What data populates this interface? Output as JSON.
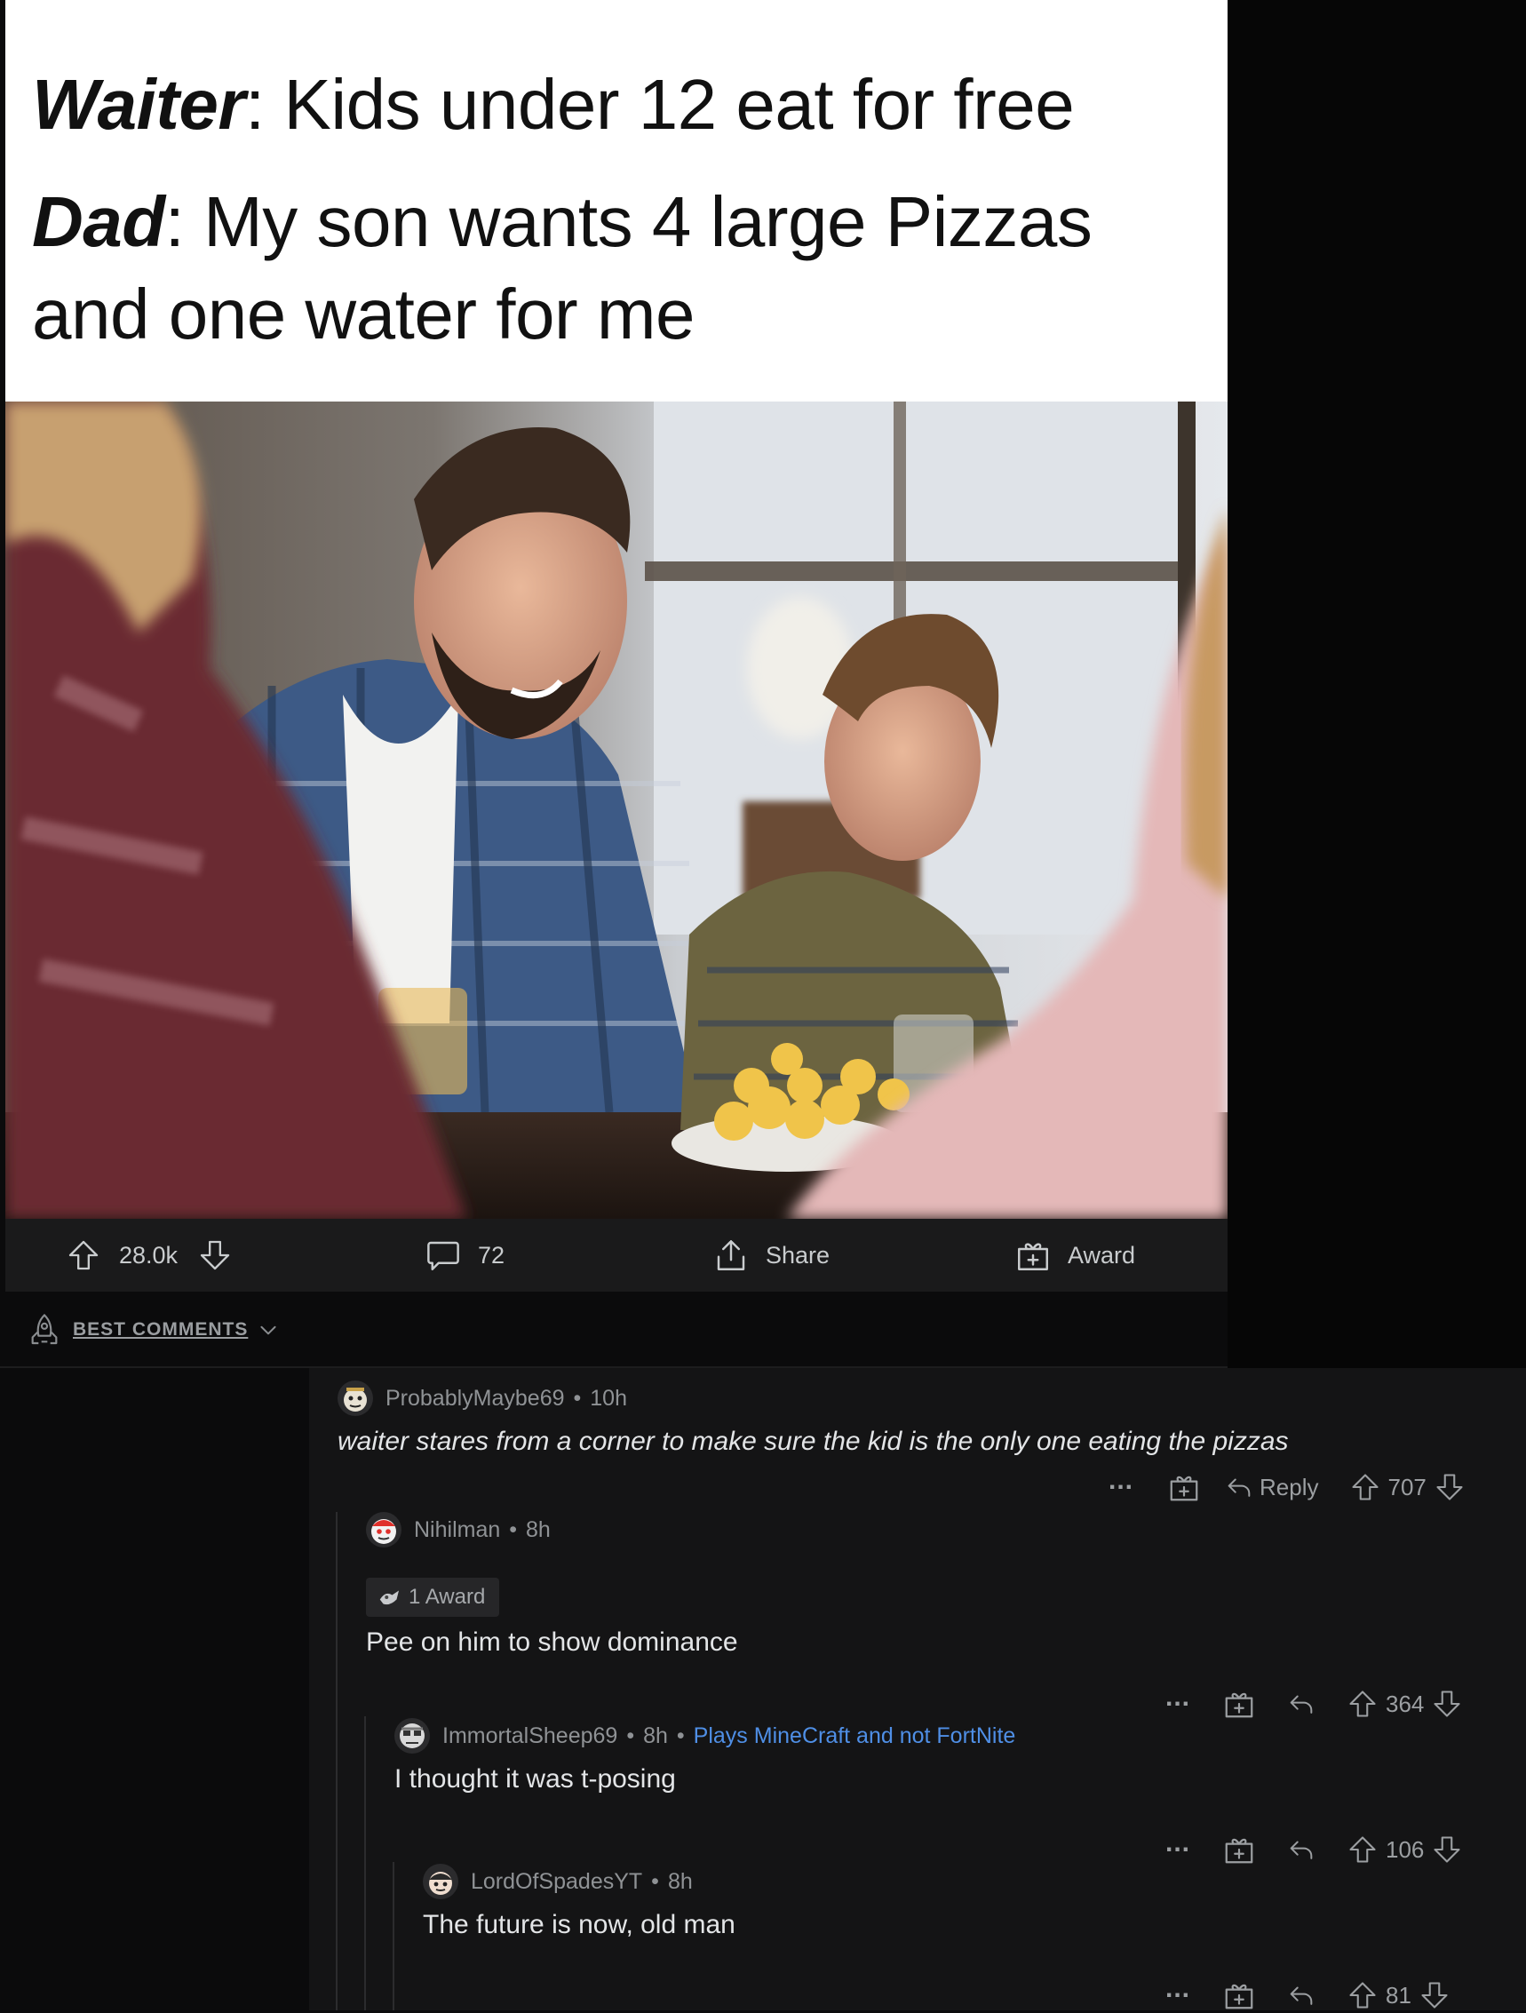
{
  "meme": {
    "waiter_speaker": "Waiter",
    "waiter_line": ": Kids under 12 eat for free",
    "dad_speaker": "Dad",
    "dad_line_1": ": My son wants 4 large Pizzas",
    "dad_line_2": "and one water for me"
  },
  "post_actions": {
    "upvotes": "28.0k",
    "comments": "72",
    "share_label": "Share",
    "award_label": "Award"
  },
  "sort": {
    "label": "BEST COMMENTS",
    "icon": "rocket-icon"
  },
  "comments": [
    {
      "author": "ProbablyMaybe69",
      "time": "10h",
      "body": "waiter stares from a corner to make sure the kid is the only one eating the pizzas",
      "reply_label": "Reply",
      "score": "707"
    },
    {
      "author": "Nihilman",
      "time": "8h",
      "award": "1 Award",
      "body": "Pee on him to show dominance",
      "score": "364"
    },
    {
      "author": "ImmortalSheep69",
      "time": "8h",
      "flair": "Plays MineCraft and not FortNite",
      "body": "I thought it was t-posing",
      "score": "106"
    },
    {
      "author": "LordOfSpadesYT",
      "time": "8h",
      "body": "The future is now, old man",
      "score": "81"
    }
  ],
  "colors": {
    "background": "#0b0b0c",
    "panel": "#141415",
    "action_bar": "#1a1a1b",
    "flair": "#4f8fe6",
    "text": "#d7dadc",
    "meta": "#8f9295"
  }
}
